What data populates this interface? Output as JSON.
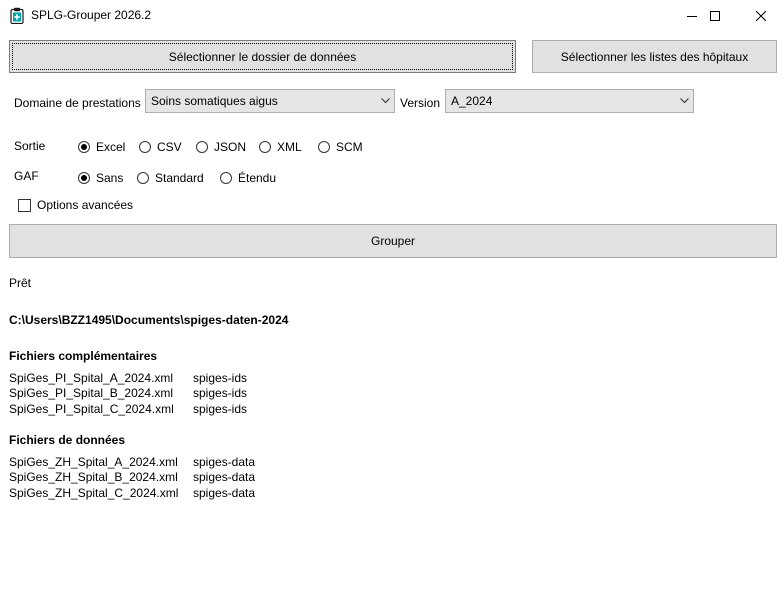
{
  "window": {
    "title": "SPLG-Grouper 2026.2"
  },
  "buttons": {
    "select_data_folder": "Sélectionner le dossier de données",
    "select_hospital_lists": "Sélectionner les listes des hôpitaux",
    "group": "Grouper"
  },
  "domain": {
    "label": "Domaine de prestations",
    "value": "Soins somatiques aigus"
  },
  "version": {
    "label": "Version",
    "value": "A_2024"
  },
  "output": {
    "label": "Sortie",
    "options": [
      "Excel",
      "CSV",
      "JSON",
      "XML",
      "SCM"
    ],
    "selected": "Excel"
  },
  "gaf": {
    "label": "GAF",
    "options": [
      "Sans",
      "Standard",
      "Étendu"
    ],
    "selected": "Sans"
  },
  "advanced": {
    "label": "Options avancées",
    "checked": false
  },
  "status": "Prêt",
  "folder_path": "C:\\Users\\BZZ1495\\Documents\\spiges-daten-2024",
  "complementary": {
    "heading": "Fichiers complémentaires",
    "files": [
      {
        "name": "SpiGes_PI_Spital_A_2024.xml",
        "type": "spiges-ids"
      },
      {
        "name": "SpiGes_PI_Spital_B_2024.xml",
        "type": "spiges-ids"
      },
      {
        "name": "SpiGes_PI_Spital_C_2024.xml",
        "type": "spiges-ids"
      }
    ]
  },
  "data_files": {
    "heading": "Fichiers de données",
    "files": [
      {
        "name": "SpiGes_ZH_Spital_A_2024.xml",
        "type": "spiges-data"
      },
      {
        "name": "SpiGes_ZH_Spital_B_2024.xml",
        "type": "spiges-data"
      },
      {
        "name": "SpiGes_ZH_Spital_C_2024.xml",
        "type": "spiges-data"
      }
    ]
  },
  "icons": {
    "app": "clipboard-icon",
    "minimize": "minimize-icon",
    "maximize": "maximize-icon",
    "close": "close-icon",
    "dropdown": "chevron-down-icon"
  },
  "colors": {
    "app_icon": "#00a4a6",
    "button_bg": "#e1e1e1",
    "combo_bg": "#e5e5e5"
  }
}
